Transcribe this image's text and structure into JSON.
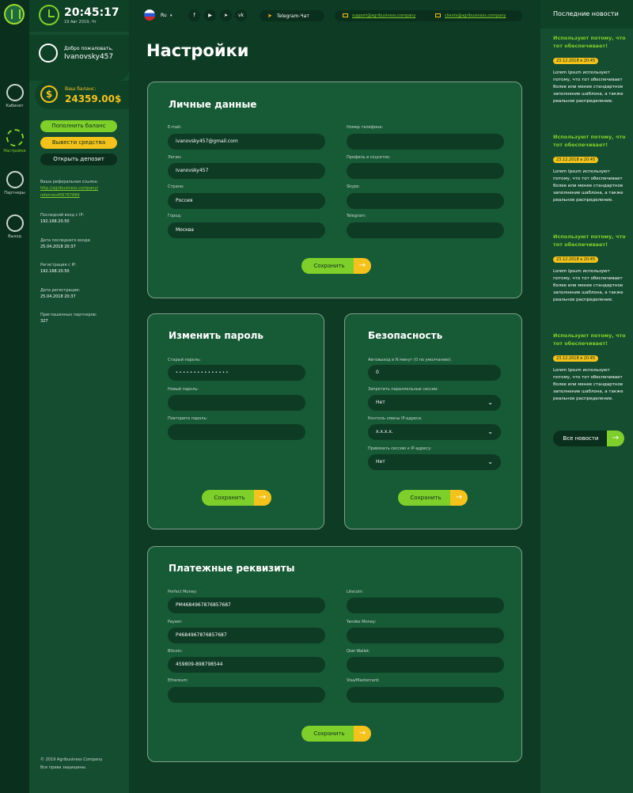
{
  "rail": {
    "items": [
      {
        "label": "Кабинет"
      },
      {
        "label": "Настройки"
      },
      {
        "label": "Партнеры"
      },
      {
        "label": "Выход"
      }
    ]
  },
  "header": {
    "time": "20:45:17",
    "date": "19 Авг 2019, Чт",
    "language": "Ru",
    "telegram_chat": "Telegram-Чат",
    "support_email": "support@agribusiness.company",
    "clients_email": "clients@agribusiness.company",
    "social": [
      "f",
      "▶",
      "➤",
      "vk"
    ]
  },
  "user": {
    "welcome": "Добро пожаловать,",
    "username": "Ivanovsky457"
  },
  "balance": {
    "label": "Ваш баланс:",
    "value": "24359.00$",
    "currency_symbol": "$"
  },
  "sidebar": {
    "btn_deposit": "Пополнить баланс",
    "btn_withdraw": "Вывести средства",
    "btn_open": "Открыть депозит",
    "ref_label": "Ваша реферальная ссылка:",
    "ref_link_1": "http://agribusiness.company/",
    "ref_link_2": "referrals456787889",
    "last_ip_label": "Последний вход с IP:",
    "last_ip": "192.168.20.50",
    "last_date_label": "Дата последнего входа:",
    "last_date": "25.04.2018  20:37",
    "reg_ip_label": "Регистрация с IP:",
    "reg_ip": "192.168.20.50",
    "reg_date_label": "Дата регистрации:",
    "reg_date": "25.04.2018  20:37",
    "partners_label": "Приглашенных партнеров:",
    "partners": "327",
    "copyright_1": "© 2019  Agribusiness Company.",
    "copyright_2": "Все права защищены."
  },
  "page_title": "Настройки",
  "personal": {
    "title": "Личные данные",
    "email_label": "E-mail:",
    "email": "ivanovsky457@gmail.com",
    "login_label": "Логин:",
    "login": "Ivanovsky457",
    "country_label": "Страна:",
    "country": "Россия",
    "city_label": "Город:",
    "city": "Москва",
    "phone_label": "Номер телефона:",
    "phone": "",
    "social_label": "Профиль в соцсетях:",
    "social": "",
    "skype_label": "Skype:",
    "skype": "",
    "telegram_label": "Telegram:",
    "telegram": "",
    "save": "Сохранить"
  },
  "password": {
    "title": "Изменить пароль",
    "old_label": "Старый пароль:",
    "old": "• • • • • • • • • • • • • • •",
    "new_label": "Новый пароль:",
    "new": "",
    "repeat_label": "Повторите пароль:",
    "repeat": "",
    "save": "Сохранить"
  },
  "security": {
    "title": "Безопасность",
    "autologout_label": "Автовыход в N минут (0 по умолчанию):",
    "autologout": "0",
    "parallel_label": "Запретить параллельные сессии:",
    "parallel": "Нет",
    "ipchange_label": "Контоль смены IP-адреса:",
    "ipchange": "x.x.x.x.",
    "bindip_label": "Привязать сессию к IP-адресу:",
    "bindip": "Нет",
    "save": "Сохранить"
  },
  "payments": {
    "title": "Платежные реквизиты",
    "pm_label": "Perfect Money:",
    "pm": "PM4684967876857687",
    "payeer_label": "Payeer:",
    "payeer": "P4684967876857687",
    "btc_label": "Bitcoin:",
    "btc": "459809-898798544",
    "eth_label": "Ethereum:",
    "eth": "",
    "ltc_label": "Litecoin:",
    "ltc": "",
    "yandex_label": "Yandex Money:",
    "yandex": "",
    "qiwi_label": "Qiwi Wallet:",
    "qiwi": "",
    "visa_label": "Visa/Mastercard:",
    "visa": "",
    "save": "Сохранить"
  },
  "news": {
    "title": "Последние новости",
    "items": [
      {
        "title": "Используют потому, что тот обеспечивает!",
        "date": "23.12.2018 в 20:45",
        "text": "Lorem Ipsum используют потому, что тот обеспечивает более или менее стандартное заполнение шаблона, а также реальное распределение."
      },
      {
        "title": "Используют потому, что тот обеспечивает!",
        "date": "23.12.2018 в 20:45",
        "text": "Lorem Ipsum используют потому, что тот обеспечивает более или менее стандартное заполнение шаблона, а также реальное распределение."
      },
      {
        "title": "Используют потому, что тот обеспечивает!",
        "date": "23.12.2018 в 20:45",
        "text": "Lorem Ipsum используют потому, что тот обеспечивает более или менее стандартное заполнение шаблона, а также реальное распределение."
      },
      {
        "title": "Используют потому, что тот обеспечивает!",
        "date": "23.12.2018 в 20:45",
        "text": "Lorem Ipsum используют потому, что тот обеспечивает более или менее стандартное заполнение шаблона, а также реальное распределение."
      }
    ],
    "all": "Все новости"
  },
  "icons": {
    "arrow": "→",
    "chevron": "⌄"
  },
  "colors": {
    "accent_green": "#7fcf2a",
    "accent_yellow": "#f4c21b",
    "background": "#0e3b24"
  }
}
